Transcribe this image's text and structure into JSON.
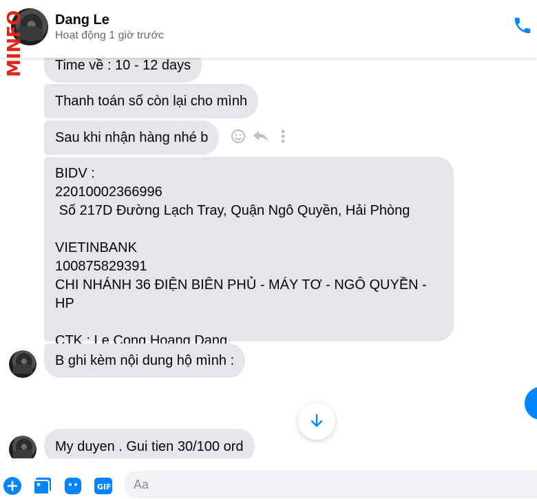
{
  "watermark": "MINFO",
  "header": {
    "name": "Dang Le",
    "status": "Hoạt động 1 giờ trước",
    "call_icon": "phone-icon"
  },
  "messages": [
    {
      "text": "Time về : 10 - 12 days"
    },
    {
      "text": "Thanh toán số còn lại cho mình"
    },
    {
      "text": "Sau khi nhận hàng nhé b"
    },
    {
      "text": "BIDV :\n22010002366996\n Số 217D Đường Lạch Tray, Quận Ngô Quyền, Hải Phòng\n\nVIETINBANK\n100875829391\nCHI NHÁNH 36 ĐIỆN BIÊN PHỦ - MÁY TƠ - NGÔ QUYỀN - HP\n\nCTK : Le Cong Hoang Dang"
    },
    {
      "text": "B ghi kèm nội dung hộ mình :"
    },
    {
      "text": "My duyen . Gui tien 30/100 ord"
    }
  ],
  "message_actions": [
    "smiley-icon",
    "reply-icon",
    "more-vertical-icon"
  ],
  "composer": {
    "placeholder": "Aa",
    "tools": [
      "plus-icon",
      "image-icon",
      "sticker-icon",
      "gif-icon"
    ]
  },
  "colors": {
    "accent": "#0084ff",
    "bubble": "#e4e6eb",
    "watermark": "#e0261b"
  }
}
